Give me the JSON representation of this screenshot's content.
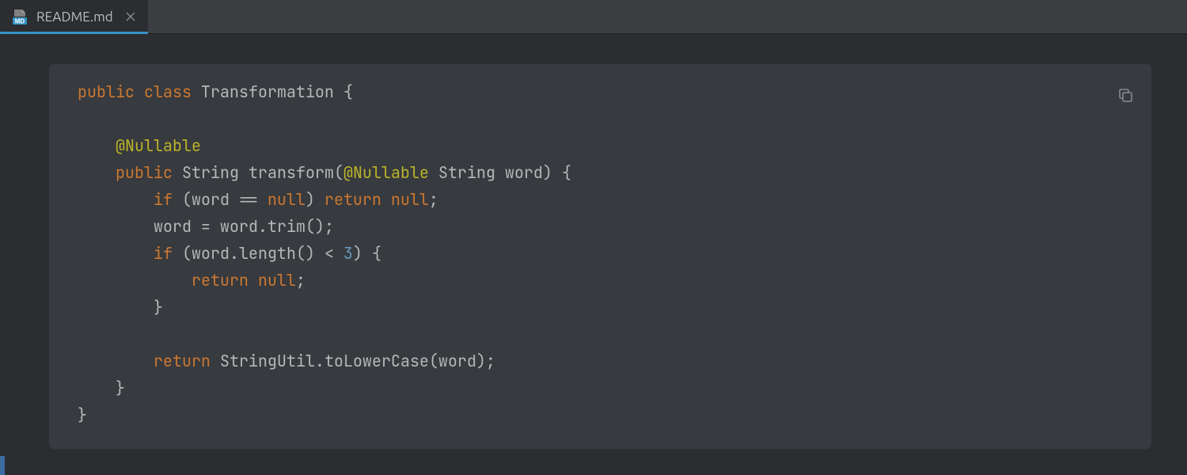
{
  "tab": {
    "filename": "README.md",
    "icon_badge": "MD"
  },
  "code": {
    "tokens": [
      {
        "t": "public",
        "c": "kw"
      },
      {
        "t": " "
      },
      {
        "t": "class",
        "c": "kw"
      },
      {
        "t": " Transformation {"
      },
      {
        "nl": true
      },
      {
        "nl": true
      },
      {
        "t": "    "
      },
      {
        "t": "@Nullable",
        "c": "anno"
      },
      {
        "nl": true
      },
      {
        "t": "    "
      },
      {
        "t": "public",
        "c": "kw"
      },
      {
        "t": " String transform("
      },
      {
        "t": "@Nullable",
        "c": "anno"
      },
      {
        "t": " String word) {"
      },
      {
        "nl": true
      },
      {
        "t": "        "
      },
      {
        "t": "if",
        "c": "kw"
      },
      {
        "t": " (word == "
      },
      {
        "t": "null",
        "c": "lit"
      },
      {
        "t": ") "
      },
      {
        "t": "return",
        "c": "kw"
      },
      {
        "t": " "
      },
      {
        "t": "null",
        "c": "lit"
      },
      {
        "t": ";"
      },
      {
        "nl": true
      },
      {
        "t": "        word = word.trim();"
      },
      {
        "nl": true
      },
      {
        "t": "        "
      },
      {
        "t": "if",
        "c": "kw"
      },
      {
        "t": " (word.length() < "
      },
      {
        "t": "3",
        "c": "num"
      },
      {
        "t": ") {"
      },
      {
        "nl": true
      },
      {
        "t": "            "
      },
      {
        "t": "return",
        "c": "kw"
      },
      {
        "t": " "
      },
      {
        "t": "null",
        "c": "lit"
      },
      {
        "t": ";"
      },
      {
        "nl": true
      },
      {
        "t": "        }"
      },
      {
        "nl": true
      },
      {
        "nl": true
      },
      {
        "t": "        "
      },
      {
        "t": "return",
        "c": "kw"
      },
      {
        "t": " StringUtil.toLowerCase(word);"
      },
      {
        "nl": true
      },
      {
        "t": "    }"
      },
      {
        "nl": true
      },
      {
        "t": "}"
      }
    ]
  }
}
